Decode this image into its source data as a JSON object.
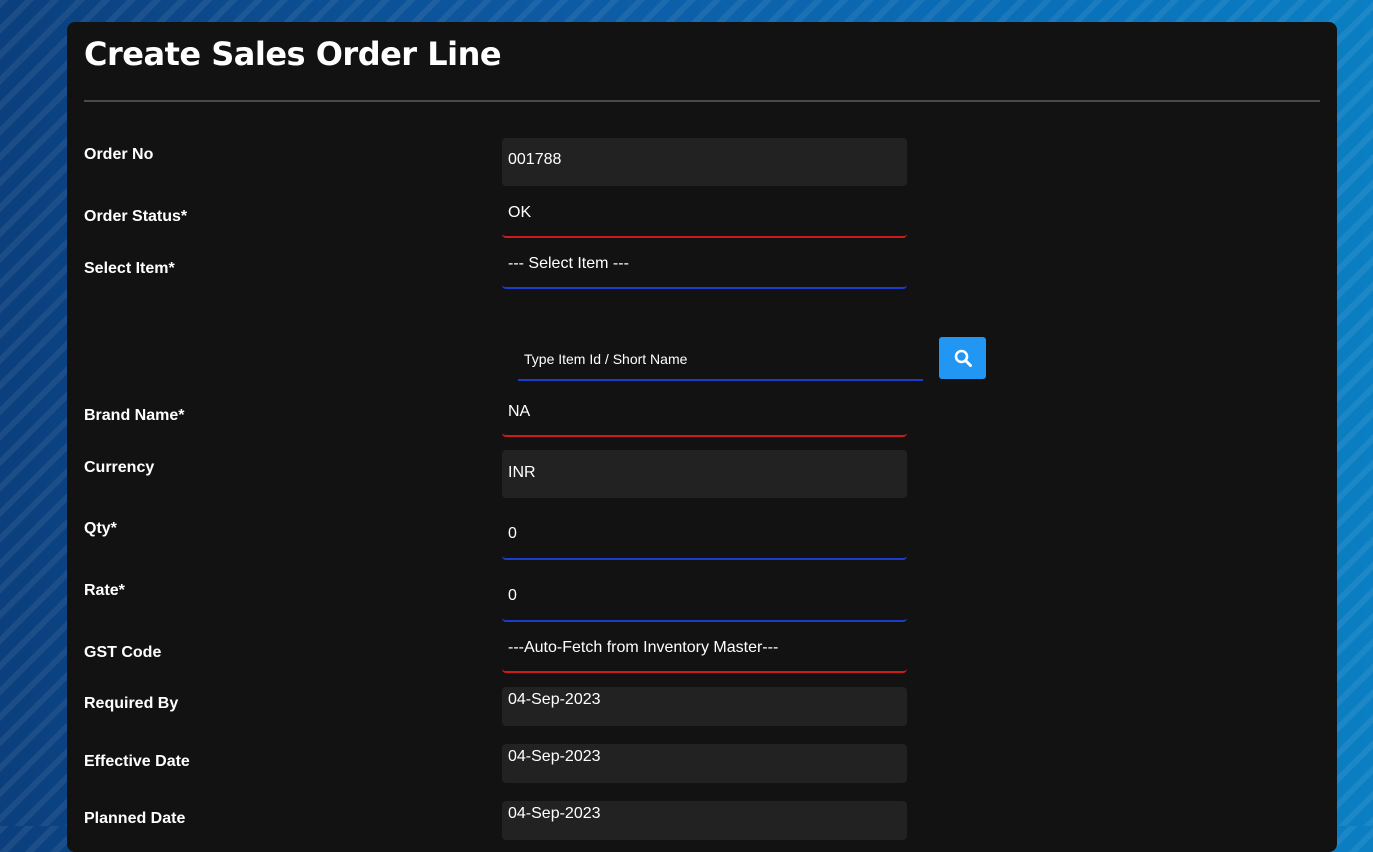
{
  "form": {
    "title": "Create Sales Order Line",
    "fields": {
      "order_no": {
        "label": "Order No",
        "value": "001788"
      },
      "order_status": {
        "label": "Order Status*",
        "value": "OK"
      },
      "select_item": {
        "label": "Select Item*",
        "value": "--- Select Item ---"
      },
      "item_search": {
        "placeholder": "Type Item Id / Short Name"
      },
      "brand_name": {
        "label": "Brand Name*",
        "value": "NA"
      },
      "currency": {
        "label": "Currency",
        "value": "INR"
      },
      "qty": {
        "label": "Qty*",
        "value": "0"
      },
      "rate": {
        "label": "Rate*",
        "value": "0"
      },
      "gst_code": {
        "label": "GST Code",
        "value": "---Auto-Fetch from Inventory Master---"
      },
      "required_by": {
        "label": "Required By",
        "value": "04-Sep-2023"
      },
      "effective_date": {
        "label": "Effective Date",
        "value": "04-Sep-2023"
      },
      "planned_date": {
        "label": "Planned Date",
        "value": "04-Sep-2023"
      }
    }
  },
  "icons": {
    "search_button": "search-icon"
  },
  "colors": {
    "card_bg": "#121212",
    "field_bg": "#222222",
    "required_underline": "#cc1b1b",
    "input_underline": "#1b3ccc",
    "search_button": "#2196f3"
  }
}
